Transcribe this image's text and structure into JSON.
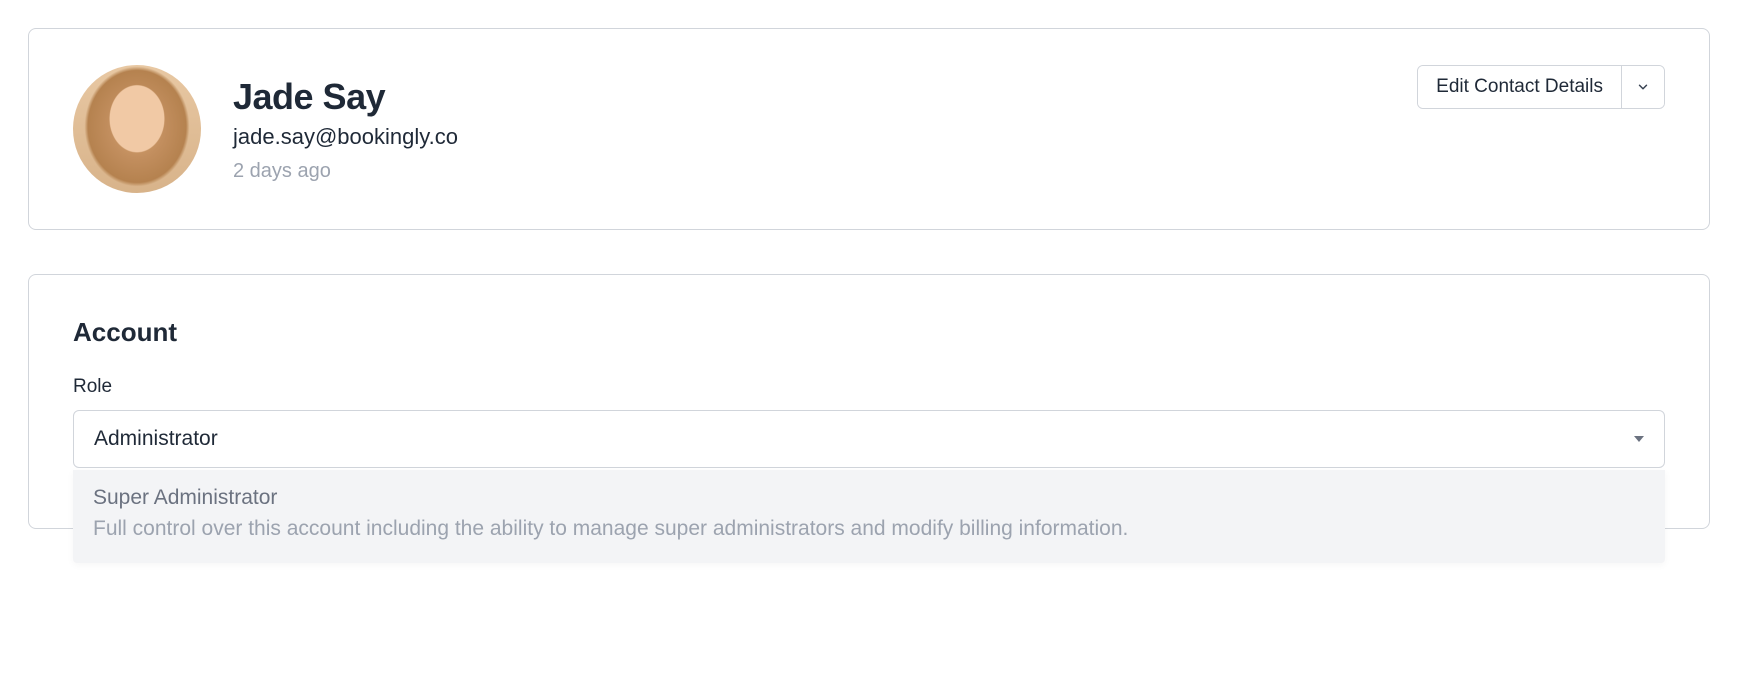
{
  "profile": {
    "name": "Jade Say",
    "email": "jade.say@bookingly.co",
    "last_seen": "2 days ago"
  },
  "actions": {
    "edit_label": "Edit Contact Details"
  },
  "account": {
    "section_title": "Account",
    "role_label": "Role",
    "role_selected": "Administrator",
    "role_dropdown": {
      "option_title": "Super Administrator",
      "option_description": "Full control over this account including the ability to manage super administrators and modify billing information."
    }
  }
}
